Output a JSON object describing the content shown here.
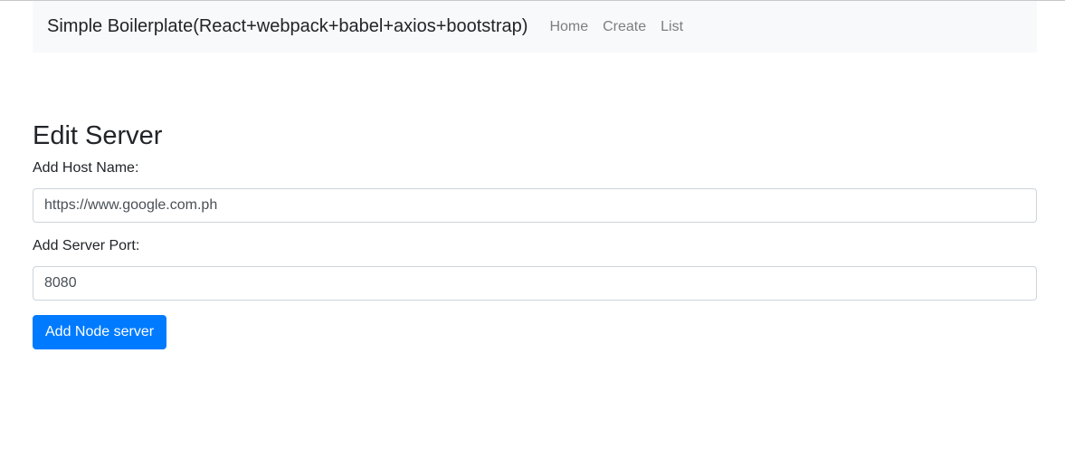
{
  "navbar": {
    "brand": "Simple Boilerplate(React+webpack+babel+axios+bootstrap)",
    "links": [
      {
        "label": "Home"
      },
      {
        "label": "Create"
      },
      {
        "label": "List"
      }
    ]
  },
  "page": {
    "title": "Edit Server"
  },
  "form": {
    "host": {
      "label": "Add Host Name:",
      "value": "https://www.google.com.ph"
    },
    "port": {
      "label": "Add Server Port:",
      "value": "8080"
    },
    "submit_label": "Add Node server"
  },
  "colors": {
    "primary": "#007bff",
    "navbar_bg": "#f8f9fa",
    "nav_link": "#7b7f83",
    "text": "#212529"
  }
}
